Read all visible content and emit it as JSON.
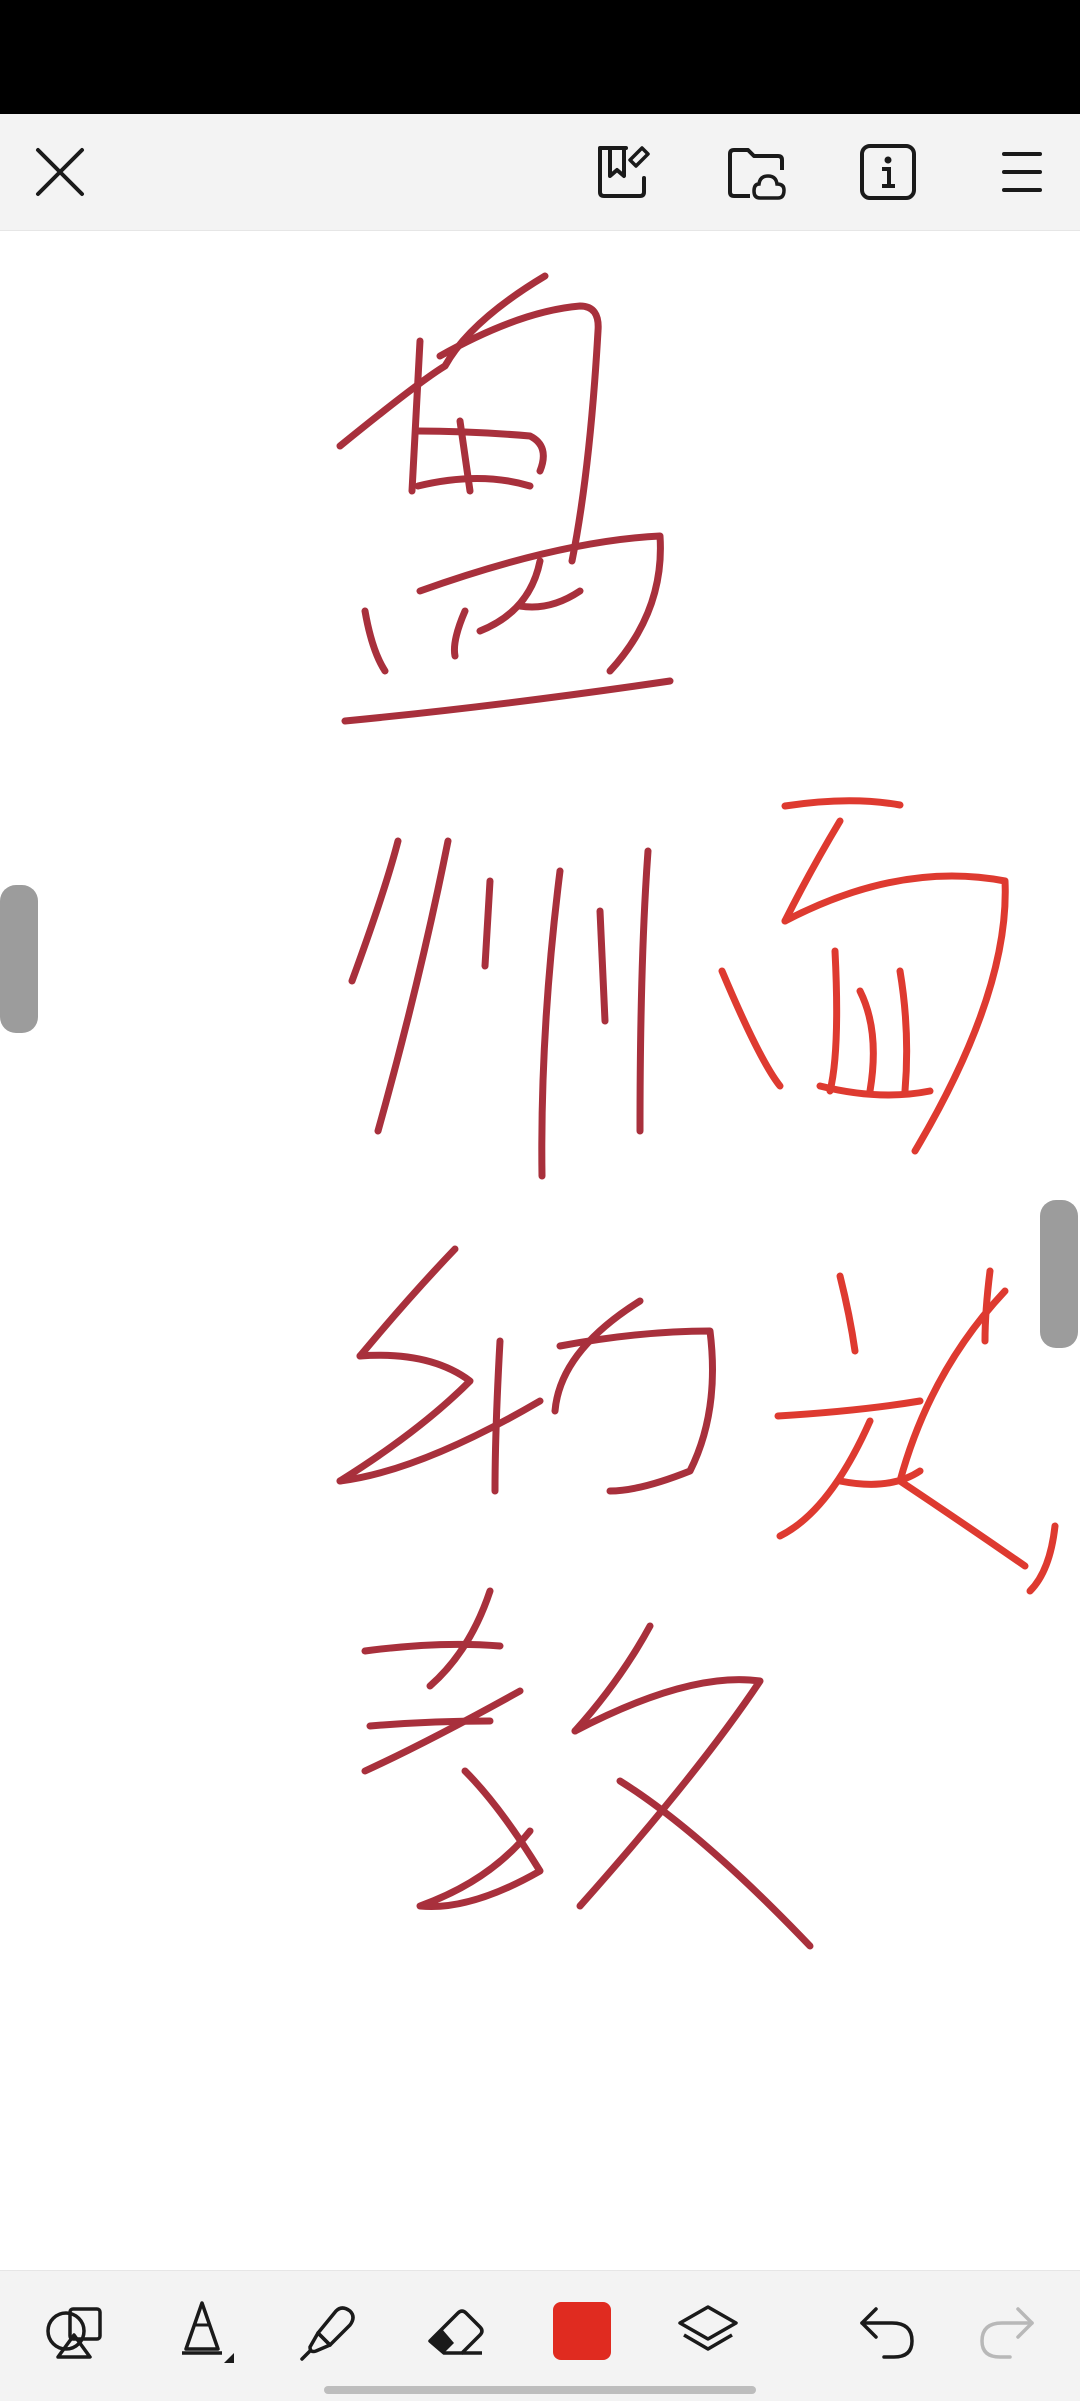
{
  "top_toolbar": {
    "icons": [
      "close-icon",
      "bookmark-edit-icon",
      "folder-cloud-icon",
      "info-icon",
      "menu-icon"
    ]
  },
  "canvas": {
    "ink_color_primary": "#b03040",
    "ink_color_secondary": "#e0322a"
  },
  "bottom_toolbar": {
    "icons": [
      "shapes-icon",
      "pencil-icon",
      "marker-icon",
      "eraser-icon",
      "color-swatch",
      "layers-icon",
      "undo-icon",
      "redo-icon"
    ],
    "selected_color": "#e02b20"
  }
}
